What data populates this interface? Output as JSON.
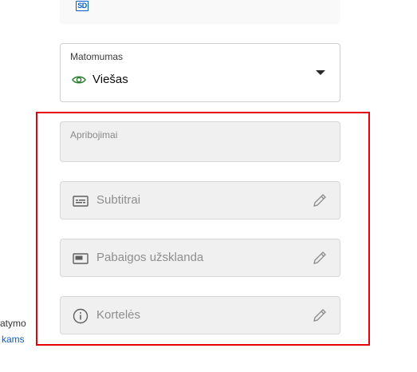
{
  "top_card": {
    "badge_text": "SD",
    "badge_icon": "sd-icon"
  },
  "visibility": {
    "label": "Matomumas",
    "value": "Viešas",
    "icon": "eye-icon",
    "icon_color": "#2e7d32"
  },
  "restrictions": {
    "label": "Apribojimai"
  },
  "rows": [
    {
      "label": "Subtitrai",
      "icon": "subtitles-icon",
      "action_icon": "pencil-icon"
    },
    {
      "label": "Pabaigos užsklanda",
      "icon": "end-screen-icon",
      "action_icon": "pencil-icon"
    },
    {
      "label": "Kortelės",
      "icon": "info-icon",
      "action_icon": "pencil-icon"
    }
  ],
  "left_cutoff": {
    "line1": "atymo",
    "line2": "kams"
  },
  "colors": {
    "highlight": "#e8000b",
    "link": "#065fd4",
    "disabled_bg": "#f0f0f0"
  }
}
